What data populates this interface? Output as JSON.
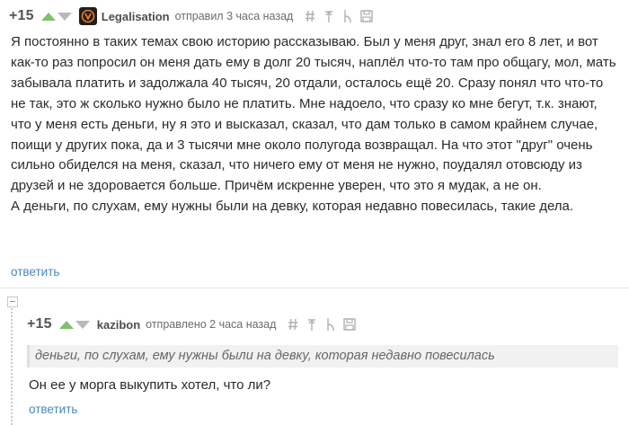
{
  "comments": [
    {
      "rating": "+15",
      "author": "Legalisation",
      "meta": "отправил 3 часа назад",
      "paragraphs": [
        "Я постоянно в таких темах свою историю рассказываю. Был у меня друг, знал его 8 лет, и вот как-то раз попросил он меня дать ему в долг 20 тысяч, наплёл что-то там про общагу, мол, мать забывала платить и задолжала 40 тысяч, 20 отдали, осталось ещё 20. Сразу понял что что-то не так, это ж сколько нужно было не платить. Мне надоело, что сразу ко мне бегут, т.к. знают, что у меня есть деньги, ну я это и высказал, сказал, что дам только в самом крайнем случае, поищи у других пока, да и 3 тысячи мне около полугода возвращал. На что этот \"друг\" очень сильно обиделся на меня, сказал, что ничего ему от меня не нужно, поудалял отовсюду из друзей и не здоровается больше. Причём искренне уверен, что это я мудак, а не он.",
        "А деньги, по слухам, ему нужны были на девку, которая недавно повесилась, такие дела."
      ],
      "reply_label": "ответить"
    },
    {
      "rating": "+15",
      "author": "kazibon",
      "meta": "отправлено 2 часа назад",
      "quote": "деньги, по слухам, ему нужны были на девку, которая недавно повесилась",
      "text": "Он ее у морга выкупить хотел, что ли?",
      "reply_label": "ответить"
    }
  ],
  "icons": [
    "hash-icon",
    "parent-arrow-icon",
    "branch-icon",
    "save-icon"
  ],
  "colors": {
    "upvote": "#7cc16b",
    "downvote": "#b9b9b9",
    "link": "#4a88bf",
    "avatar_bg": "#1e1e1e",
    "avatar_accent": "#f07a1a"
  }
}
